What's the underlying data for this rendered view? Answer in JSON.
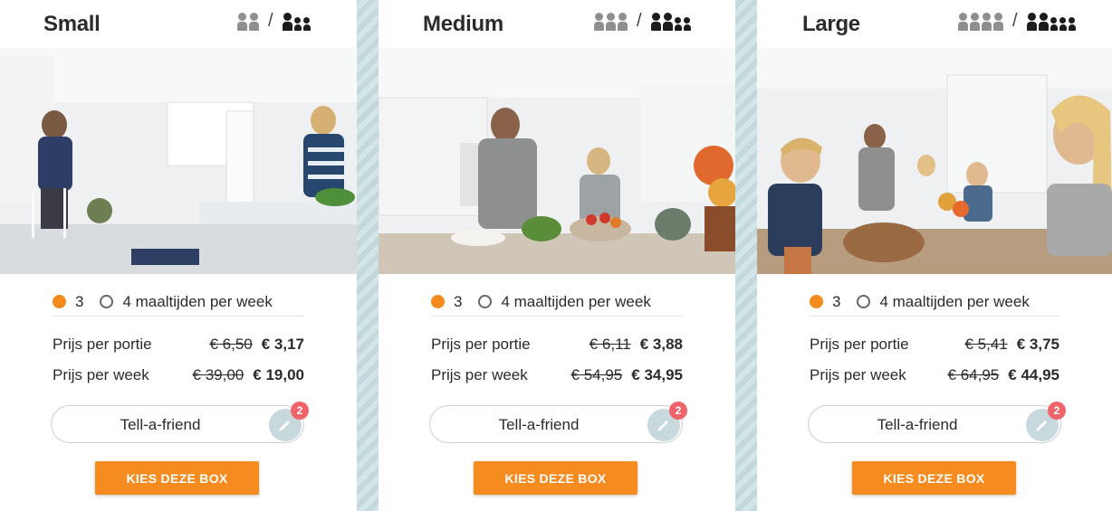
{
  "cards": [
    {
      "title": "Small",
      "option_3_label": "3",
      "option_4_label": "4 maaltijden per week",
      "selected_option": "3",
      "price_per_portion_label": "Prijs per portie",
      "price_per_portion_old": "€ 6,50",
      "price_per_portion_new": "€ 3,17",
      "price_per_week_label": "Prijs per week",
      "price_per_week_old": "€ 39,00",
      "price_per_week_new": "€ 19,00",
      "tell_label": "Tell-a-friend",
      "tell_badge": "2",
      "cta_label": "KIES DEZE BOX",
      "people_grey": 2,
      "people_dark_adults": 1,
      "people_dark_kids": 2
    },
    {
      "title": "Medium",
      "option_3_label": "3",
      "option_4_label": "4 maaltijden per week",
      "selected_option": "3",
      "price_per_portion_label": "Prijs per portie",
      "price_per_portion_old": "€ 6,11",
      "price_per_portion_new": "€ 3,88",
      "price_per_week_label": "Prijs per week",
      "price_per_week_old": "€ 54,95",
      "price_per_week_new": "€ 34,95",
      "tell_label": "Tell-a-friend",
      "tell_badge": "2",
      "cta_label": "KIES DEZE BOX",
      "people_grey": 3,
      "people_dark_adults": 2,
      "people_dark_kids": 2
    },
    {
      "title": "Large",
      "option_3_label": "3",
      "option_4_label": "4 maaltijden per week",
      "selected_option": "3",
      "price_per_portion_label": "Prijs per portie",
      "price_per_portion_old": "€ 5,41",
      "price_per_portion_new": "€ 3,75",
      "price_per_week_label": "Prijs per week",
      "price_per_week_old": "€ 64,95",
      "price_per_week_new": "€ 44,95",
      "tell_label": "Tell-a-friend",
      "tell_badge": "2",
      "cta_label": "KIES DEZE BOX",
      "people_grey": 4,
      "people_dark_adults": 2,
      "people_dark_kids": 3
    }
  ],
  "colors": {
    "accent": "#f68b1f",
    "badge": "#f0636b",
    "pencil_bg": "#c7d9dd",
    "divider_bg": "#c9dde0"
  },
  "icons": {
    "size_grey": "people-outline-icon",
    "size_dark": "people-filled-icon",
    "tell": "pencil-icon"
  },
  "photos": [
    "kitchen-photo",
    "kitchen-photo",
    "kitchen-photo"
  ]
}
